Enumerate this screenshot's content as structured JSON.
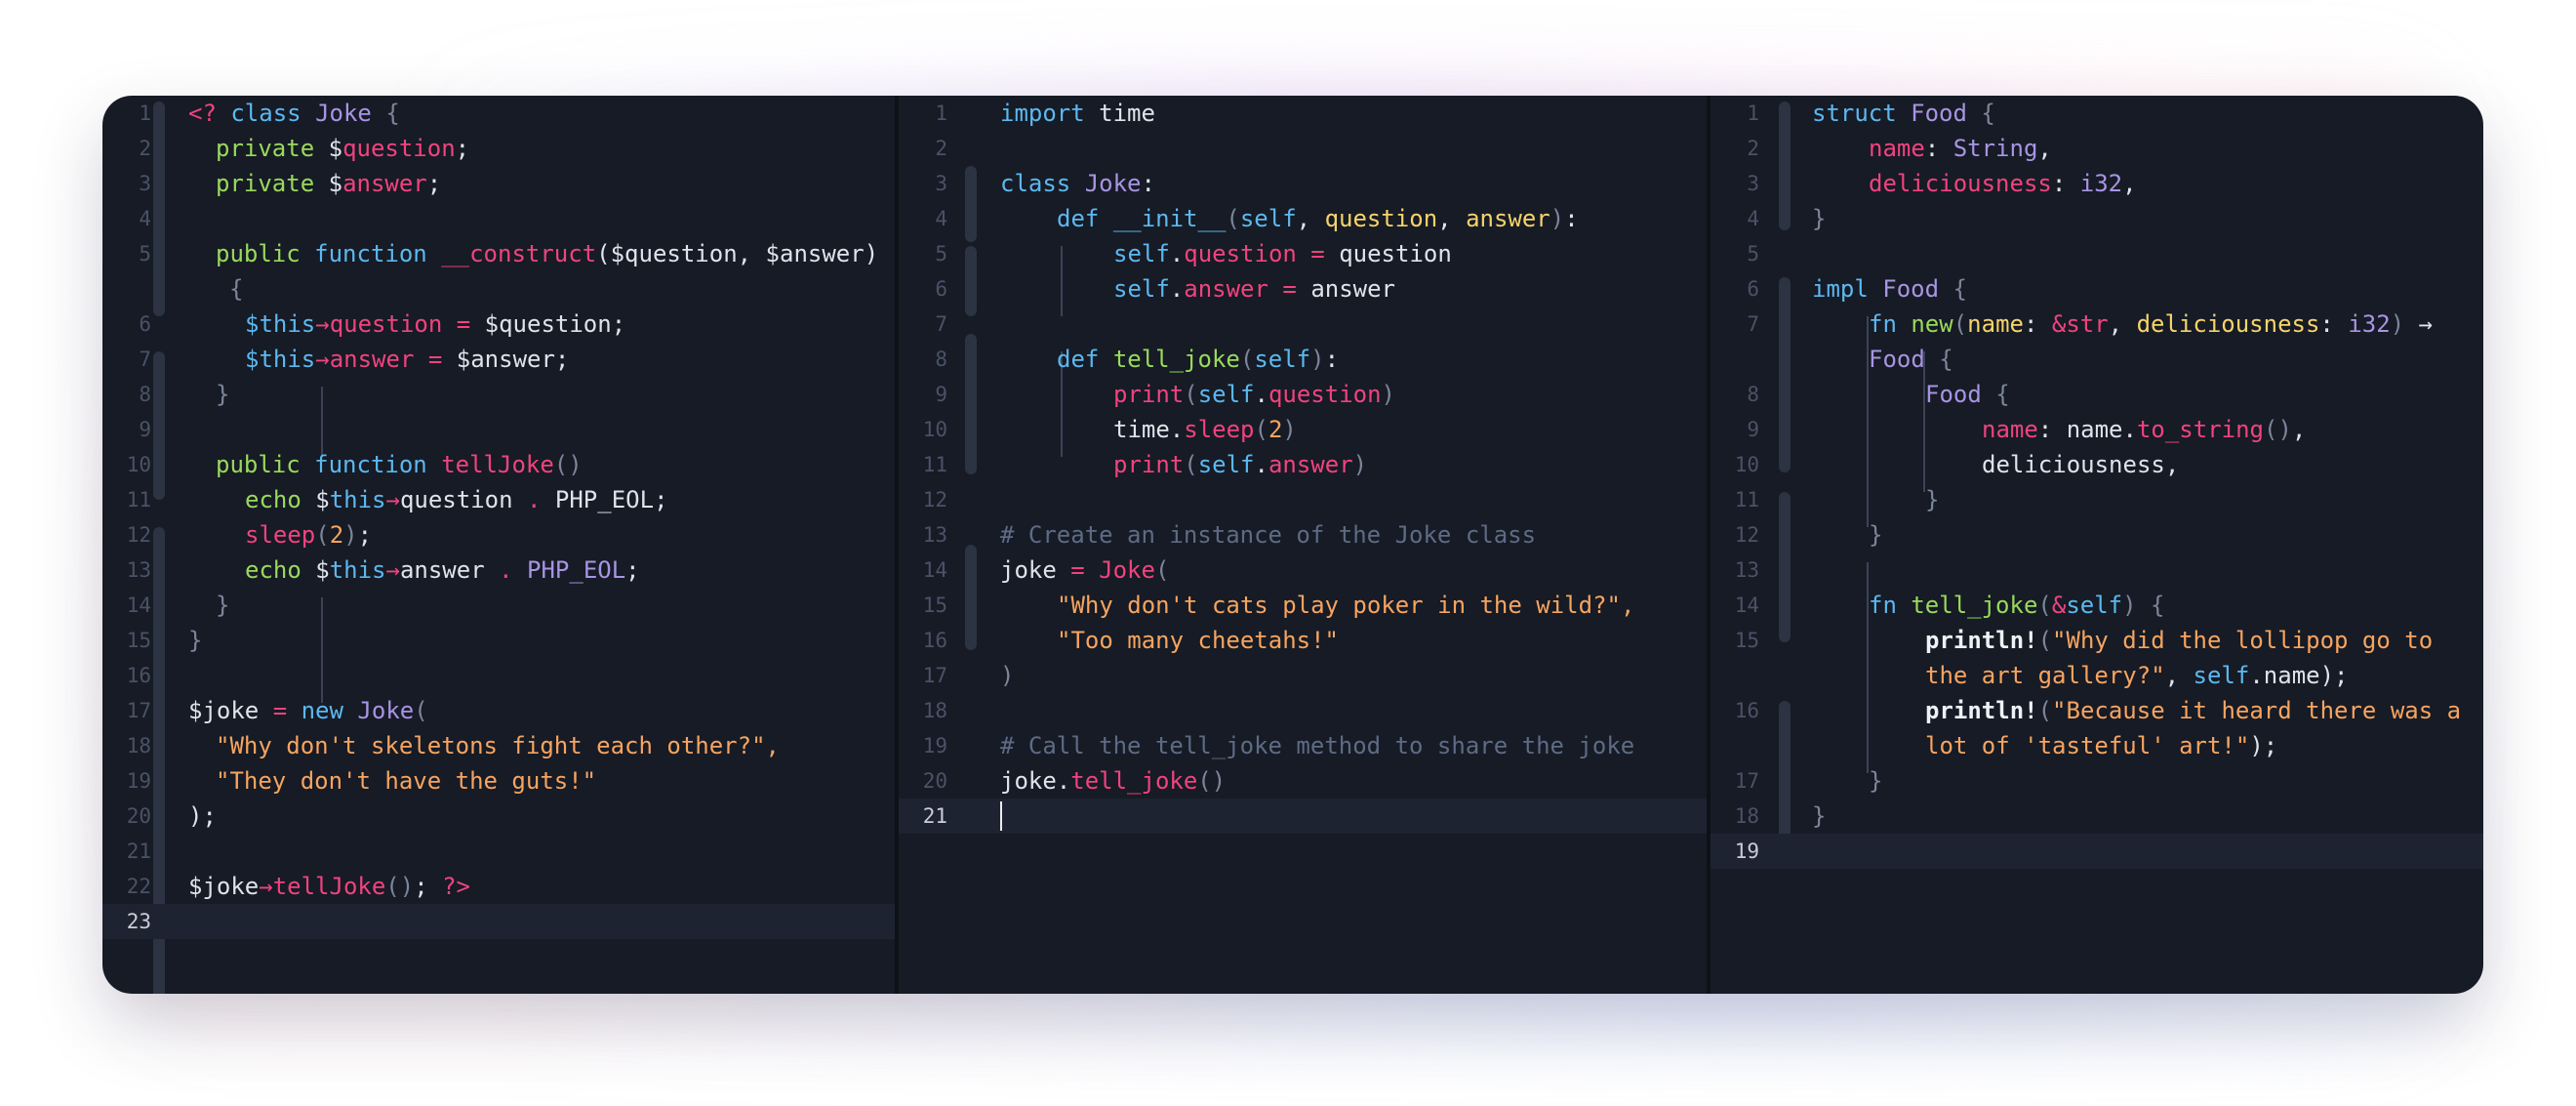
{
  "php": {
    "line_numbers": [
      "1",
      "2",
      "3",
      "4",
      "5",
      "",
      "6",
      "7",
      "8",
      "9",
      "10",
      "11",
      "12",
      "13",
      "14",
      "15",
      "16",
      "17",
      "18",
      "19",
      "20",
      "21",
      "22",
      "23"
    ],
    "tokens": {
      "open_tag": "<?",
      "class_kw": "class",
      "class_name": "Joke",
      "brace_open": "{",
      "private": "private",
      "question_var": "question",
      "answer_var": "answer",
      "dollar": "$",
      "semi": ";",
      "public": "public",
      "function": "function",
      "construct": "__construct",
      "construct_params": "($question, $answer)",
      "this": "$this",
      "arrow": "→",
      "question": "question",
      "answer": "answer",
      "eq": "=",
      "q_assign": "$question;",
      "a_assign": "$answer;",
      "brace_close": "}",
      "tellJoke": "tellJoke",
      "parens": "()",
      "echo": "echo",
      "dot": ".",
      "php_eol": "PHP_EOL",
      "sleep": "sleep",
      "two": "2",
      "joke_var": "$joke",
      "new": "new",
      "str1": "\"Why don't skeletons fight each other?\",",
      "str2": "\"They don't have the guts!\"",
      "close_call": ");",
      "close_tag": "?>"
    }
  },
  "python": {
    "line_numbers": [
      "1",
      "2",
      "3",
      "4",
      "5",
      "6",
      "7",
      "8",
      "9",
      "10",
      "11",
      "12",
      "13",
      "14",
      "15",
      "16",
      "17",
      "18",
      "19",
      "20",
      "21"
    ],
    "tokens": {
      "import": "import",
      "time": "time",
      "class": "class",
      "Joke": "Joke",
      "colon": ":",
      "def": "def",
      "init": "__init__",
      "self": "self",
      "question": "question",
      "answer": "answer",
      "comma": ",",
      "eq": "=",
      "tell_joke": "tell_joke",
      "print": "print",
      "sleep": "sleep",
      "two": "2",
      "comment1": "# Create an instance of the Joke class",
      "joke": "joke",
      "str1": "\"Why don't cats play poker in the wild?\",",
      "str2": "\"Too many cheetahs!\"",
      "comment2": "# Call the tell_joke method to share the joke"
    }
  },
  "rust": {
    "line_numbers": [
      "1",
      "2",
      "3",
      "4",
      "5",
      "6",
      "7",
      "",
      "8",
      "9",
      "10",
      "11",
      "12",
      "13",
      "14",
      "15",
      "",
      "16",
      "",
      "17",
      "18",
      "19"
    ],
    "tokens": {
      "struct": "struct",
      "Food": "Food",
      "name": "name",
      "String": "String",
      "deliciousness": "deliciousness",
      "i32": "i32",
      "impl": "impl",
      "fn": "fn",
      "new": "new",
      "amp_str": "&str",
      "arrow": "→",
      "to_string": "to_string",
      "tell_joke": "tell_joke",
      "amp_self": "&self",
      "self": "self",
      "println": "println!",
      "str1a": "\"Why did the lollipop go to",
      "str1b": "the art gallery?\"",
      "name_field": "name",
      "str2a": "\"Because it heard there was a",
      "str2b": "lot of 'tasteful' art!\""
    }
  }
}
